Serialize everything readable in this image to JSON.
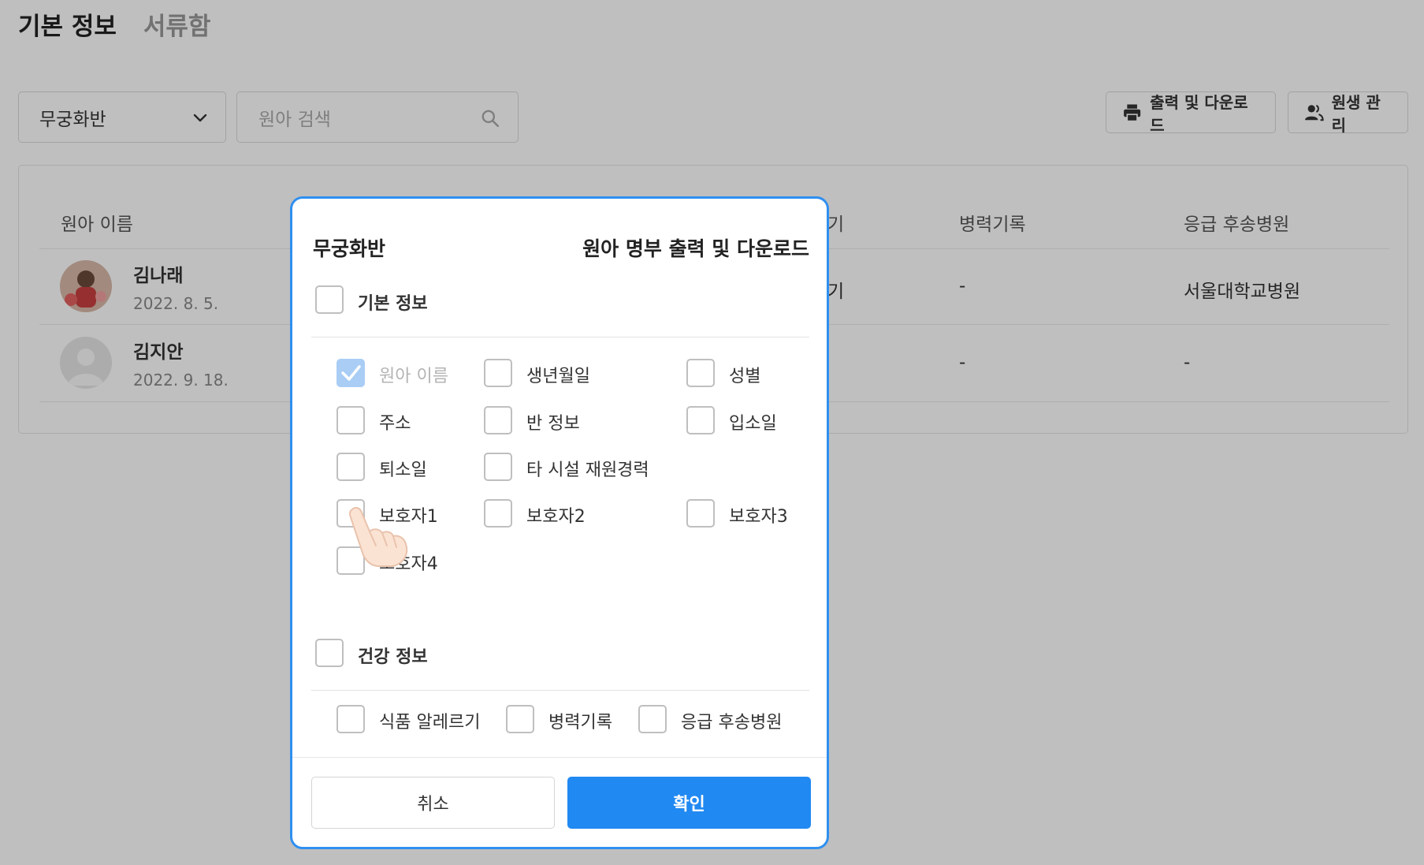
{
  "tabs": [
    {
      "label": "기본 정보"
    },
    {
      "label": "서류함"
    }
  ],
  "toolbar": {
    "class_select": "무궁화반",
    "search_placeholder": "원아 검색",
    "print_label": "출력 및 다운로드",
    "students_label": "원생 관리"
  },
  "table": {
    "headers": [
      "원아 이름",
      "병력기록",
      "응급 후송병원"
    ],
    "partial_header": "기",
    "rows": [
      {
        "name": "김나래",
        "date": "2022. 8. 5.",
        "partial": "기",
        "medical": "-",
        "hospital": "서울대학교병원"
      },
      {
        "name": "김지안",
        "date": "2022. 9. 18.",
        "medical": "-",
        "hospital": "-"
      }
    ]
  },
  "modal": {
    "class_name": "무궁화반",
    "title": "원아 명부 출력 및 다운로드",
    "basic_section": "기본 정보",
    "basic_fields": [
      "원아 이름",
      "생년월일",
      "성별",
      "주소",
      "반 정보",
      "입소일",
      "퇴소일",
      "타 시설 재원경력",
      "보호자1",
      "보호자2",
      "보호자3",
      "보호자4"
    ],
    "health_section": "건강 정보",
    "health_fields": [
      "식품 알레르기",
      "병력기록",
      "응급 후송병원"
    ],
    "cancel_label": "취소",
    "ok_label": "확인"
  },
  "colors": {
    "accent": "#2089f2",
    "modal_border": "#2f8ff0",
    "checked_fill": "#a9cdf5"
  }
}
